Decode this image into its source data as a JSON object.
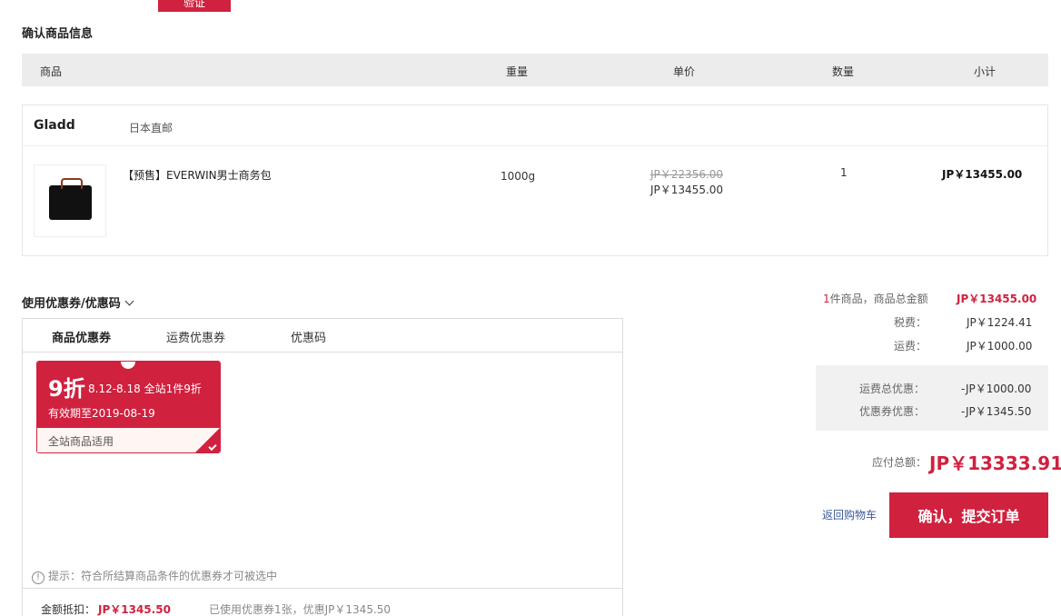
{
  "top_button": {
    "label": "验证"
  },
  "section_title": "确认商品信息",
  "table_header": {
    "product": "商品",
    "weight": "重量",
    "unit_price": "单价",
    "quantity": "数量",
    "subtotal": "小计"
  },
  "shop": {
    "name": "Gladd",
    "tag": "日本直邮",
    "item": {
      "image_icon": "briefcase-icon",
      "name": "【预售】EVERWIN男士商务包",
      "weight": "1000g",
      "price_original": "JP￥22356.00",
      "price_current": "JP￥13455.00",
      "quantity": "1",
      "subtotal": "JP￥13455.00"
    }
  },
  "coupons": {
    "title": "使用优惠券/优惠码",
    "tabs": [
      {
        "label": "商品优惠券"
      },
      {
        "label": "运费优惠券"
      },
      {
        "label": "优惠码"
      }
    ],
    "card": {
      "discount": "9折",
      "description": "8.12-8.18 全站1件9折",
      "validity": "有效期至2019-08-19",
      "scope": "全站商品适用"
    },
    "tip": "提示：符合所结算商品条件的优惠券才可被选中",
    "discount_label": "金额抵扣：",
    "discount_value": "JP￥1345.50",
    "used_info": "已使用优惠券1张，优惠JP￥1345.50"
  },
  "summary": {
    "item_count": "1",
    "item_count_suffix": "件商品，商品总金额",
    "items_total": "JP￥13455.00",
    "tax_label": "税费：",
    "tax_value": "JP￥1224.41",
    "shipping_label": "运费：",
    "shipping_value": "JP￥1000.00",
    "shipping_discount_label": "运费总优惠：",
    "shipping_discount_value": "-JP￥1000.00",
    "coupon_discount_label": "优惠券优惠：",
    "coupon_discount_value": "-JP￥1345.50",
    "total_label": "应付总额：",
    "total_value": "JP￥13333.91",
    "back_link": "返回购物车",
    "submit_label": "确认，提交订单"
  },
  "colors": {
    "accent": "#d0213f",
    "header_bg": "#ececec"
  }
}
